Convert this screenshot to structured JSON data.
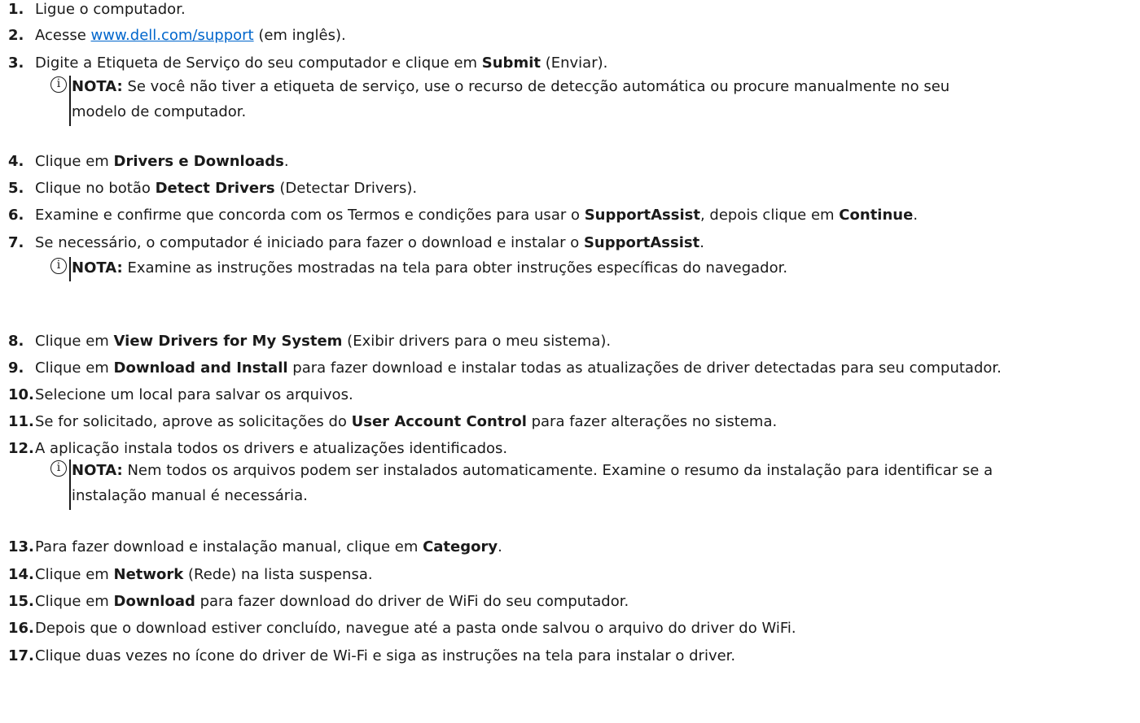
{
  "steps": [
    {
      "num": "1.",
      "parts": [
        {
          "t": "Ligue o computador."
        }
      ]
    },
    {
      "num": "2.",
      "parts": [
        {
          "t": "Acesse "
        },
        {
          "t": "www.dell.com/support",
          "link": true
        },
        {
          "t": " (em inglês)."
        }
      ]
    },
    {
      "num": "3.",
      "parts": [
        {
          "t": "Digite a Etiqueta de Serviço do seu computador e clique em "
        },
        {
          "t": "Submit",
          "b": true
        },
        {
          "t": " (Enviar)."
        }
      ]
    },
    {
      "num": "4.",
      "parts": [
        {
          "t": "Clique em "
        },
        {
          "t": "Drivers e Downloads",
          "b": true
        },
        {
          "t": "."
        }
      ]
    },
    {
      "num": "5.",
      "parts": [
        {
          "t": "Clique no botão "
        },
        {
          "t": "Detect Drivers",
          "b": true
        },
        {
          "t": " (Detectar Drivers)."
        }
      ]
    },
    {
      "num": "6.",
      "parts": [
        {
          "t": "Examine e confirme que concorda com os Termos e condições para usar o "
        },
        {
          "t": "SupportAssist",
          "b": true
        },
        {
          "t": ", depois clique em "
        },
        {
          "t": "Continue",
          "b": true
        },
        {
          "t": "."
        }
      ]
    },
    {
      "num": "7.",
      "parts": [
        {
          "t": "Se necessário, o computador é iniciado para fazer o download e instalar o "
        },
        {
          "t": "SupportAssist",
          "b": true
        },
        {
          "t": "."
        }
      ]
    },
    {
      "num": "8.",
      "parts": [
        {
          "t": "Clique em "
        },
        {
          "t": "View Drivers for My System",
          "b": true
        },
        {
          "t": " (Exibir drivers para o meu sistema)."
        }
      ]
    },
    {
      "num": "9.",
      "parts": [
        {
          "t": "Clique em "
        },
        {
          "t": "Download and Install",
          "b": true
        },
        {
          "t": " para fazer download e instalar todas as atualizações de driver detectadas para seu computador."
        }
      ]
    },
    {
      "num": "10.",
      "parts": [
        {
          "t": "Selecione um local para salvar os arquivos."
        }
      ]
    },
    {
      "num": "11.",
      "parts": [
        {
          "t": "Se for solicitado, aprove as solicitações do "
        },
        {
          "t": "User Account Control",
          "b": true
        },
        {
          "t": " para fazer alterações no sistema."
        }
      ]
    },
    {
      "num": "12.",
      "parts": [
        {
          "t": "A aplicação instala todos os drivers e atualizações identificados."
        }
      ]
    },
    {
      "num": "13.",
      "parts": [
        {
          "t": "Para fazer download e instalação manual, clique em "
        },
        {
          "t": "Category",
          "b": true
        },
        {
          "t": "."
        }
      ]
    },
    {
      "num": "14.",
      "parts": [
        {
          "t": "Clique em "
        },
        {
          "t": "Network",
          "b": true
        },
        {
          "t": " (Rede) na lista suspensa."
        }
      ]
    },
    {
      "num": "15.",
      "parts": [
        {
          "t": "Clique em "
        },
        {
          "t": "Download",
          "b": true
        },
        {
          "t": " para fazer download do driver de WiFi do seu computador."
        }
      ]
    },
    {
      "num": "16.",
      "parts": [
        {
          "t": "Depois que o download estiver concluído, navegue até a pasta onde salvou o arquivo do driver do WiFi."
        }
      ]
    },
    {
      "num": "17.",
      "parts": [
        {
          "t": "Clique duas vezes no ícone do driver de Wi-Fi e siga as instruções na tela para instalar o driver."
        }
      ]
    }
  ],
  "notes": [
    {
      "icon": "info-icon",
      "label": "NOTA:",
      "lines": [
        "Se você não tiver a etiqueta de serviço, use o recurso de detecção automática ou procure manualmente no seu",
        "modelo de computador."
      ]
    },
    {
      "icon": "info-icon",
      "label": "NOTA:",
      "lines": [
        "Examine as instruções mostradas na tela para obter instruções específicas do navegador."
      ]
    },
    {
      "icon": "info-icon",
      "label": "NOTA:",
      "lines": [
        "Nem todos os arquivos podem ser instalados automaticamente. Examine o resumo da instalação para identificar se a",
        "instalação manual é necessária."
      ]
    }
  ]
}
